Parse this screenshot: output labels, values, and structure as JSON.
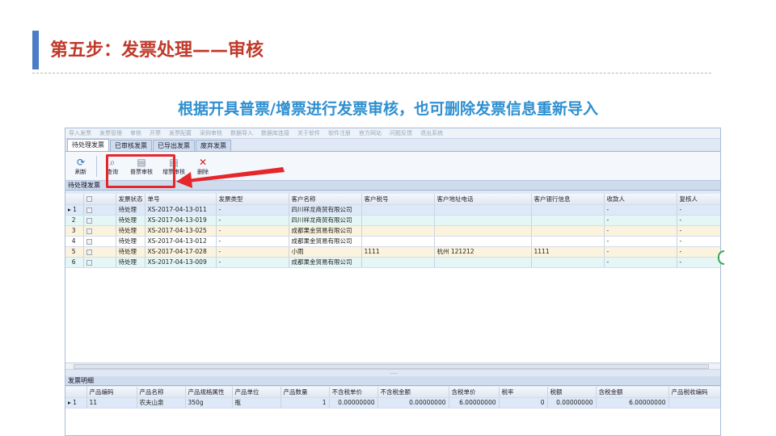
{
  "slide": {
    "title": "第五步：发票处理——审核",
    "subtitle": "根据开具普票/增票进行发票审核，也可删除发票信息重新导入"
  },
  "app": {
    "menu": [
      "导入发票",
      "发票管理",
      "审核",
      "开票",
      "发票配置",
      "采购审核",
      "数据导入",
      "数据库连接",
      "关于软件",
      "软件注册",
      "官方网站",
      "问题反馈",
      "退出系统"
    ],
    "tabs": [
      "待处理发票",
      "已审核发票",
      "已导出发票",
      "废弃发票"
    ],
    "toolbar": {
      "refresh": "刷新",
      "query": "查询",
      "normal_audit": "普票审核",
      "vat_audit": "增票审核",
      "delete": "删除"
    },
    "pending_title": "待处理发票",
    "pending_columns": [
      "",
      "",
      "发票状态",
      "单号",
      "发票类型",
      "客户名称",
      "客户税号",
      "客户地址电话",
      "客户银行信息",
      "收款人",
      "复核人"
    ],
    "pending_rows": [
      {
        "idx": "1",
        "status": "待处理",
        "no": "XS-2017-04-13-011",
        "type": "-",
        "customer": "四川祥龙商贸有限公司",
        "taxno": "",
        "addr": "",
        "bank": "",
        "payee": "-",
        "reviewer": "-"
      },
      {
        "idx": "2",
        "status": "待处理",
        "no": "XS-2017-04-13-019",
        "type": "-",
        "customer": "四川祥龙商贸有限公司",
        "taxno": "",
        "addr": "",
        "bank": "",
        "payee": "-",
        "reviewer": "-"
      },
      {
        "idx": "3",
        "status": "待处理",
        "no": "XS-2017-04-13-025",
        "type": "-",
        "customer": "成都果金贸易有限公司",
        "taxno": "",
        "addr": "",
        "bank": "",
        "payee": "-",
        "reviewer": "-"
      },
      {
        "idx": "4",
        "status": "待处理",
        "no": "XS-2017-04-13-012",
        "type": "-",
        "customer": "成都果金贸易有限公司",
        "taxno": "",
        "addr": "",
        "bank": "",
        "payee": "-",
        "reviewer": "-"
      },
      {
        "idx": "5",
        "status": "待处理",
        "no": "XS-2017-04-17-028",
        "type": "-",
        "customer": "小雨",
        "taxno": "1111",
        "addr": "杭州  121212",
        "bank": "1111",
        "payee": "-",
        "reviewer": "-"
      },
      {
        "idx": "6",
        "status": "待处理",
        "no": "XS-2017-04-13-009",
        "type": "-",
        "customer": "成都果金贸易有限公司",
        "taxno": "",
        "addr": "",
        "bank": "",
        "payee": "-",
        "reviewer": "-"
      }
    ],
    "splitter_text": "....",
    "detail_title": "发票明细",
    "detail_columns": [
      "",
      "产品编码",
      "产品名称",
      "产品规格属性",
      "产品单位",
      "产品数量",
      "不含税单价",
      "不含税金额",
      "含税单价",
      "税率",
      "税额",
      "含税金额",
      "产品税收编码"
    ],
    "detail_rows": [
      {
        "idx": "1",
        "code": "11",
        "name": "农夫山泉",
        "spec": "350g",
        "unit": "瓶",
        "qty": "1",
        "price_ex": "0.00000000",
        "amount_ex": "0.00000000",
        "price_in": "6.00000000",
        "rate": "0",
        "tax": "0.00000000",
        "amount_in": "6.00000000",
        "taxcode": ""
      }
    ]
  }
}
